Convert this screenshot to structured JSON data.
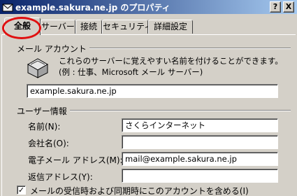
{
  "window": {
    "title": "example.sakura.ne.jp のプロパティ",
    "help_button": "?",
    "close_button": "X"
  },
  "tabs": [
    {
      "label": "全般",
      "active": true
    },
    {
      "label": "サーバー",
      "active": false
    },
    {
      "label": "接続",
      "active": false
    },
    {
      "label": "セキュリティ",
      "active": false
    },
    {
      "label": "詳細設定",
      "active": false
    }
  ],
  "mail_account": {
    "heading": "メール アカウント",
    "description": "これらのサーバーに覚えやすい名前を付けることができます。(例 : 仕事、Microsoft メール サーバー)",
    "account_name": "example.sakura.ne.jp"
  },
  "user_info": {
    "heading": "ユーザー情報",
    "name_label": "名前(N):",
    "name_value": "さくらインターネット",
    "company_label": "会社名(O):",
    "company_value": "",
    "email_label": "電子メール アドレス(M):",
    "email_value": "mail@example.sakura.ne.jp",
    "reply_label": "返信アドレス(Y):",
    "reply_value": ""
  },
  "include_account": {
    "label": "メールの受信時および同期時にこのアカウントを含める(I)",
    "checked": true
  },
  "colors": {
    "highlight_circle": "#e01010",
    "titlebar": "#0a246a"
  }
}
